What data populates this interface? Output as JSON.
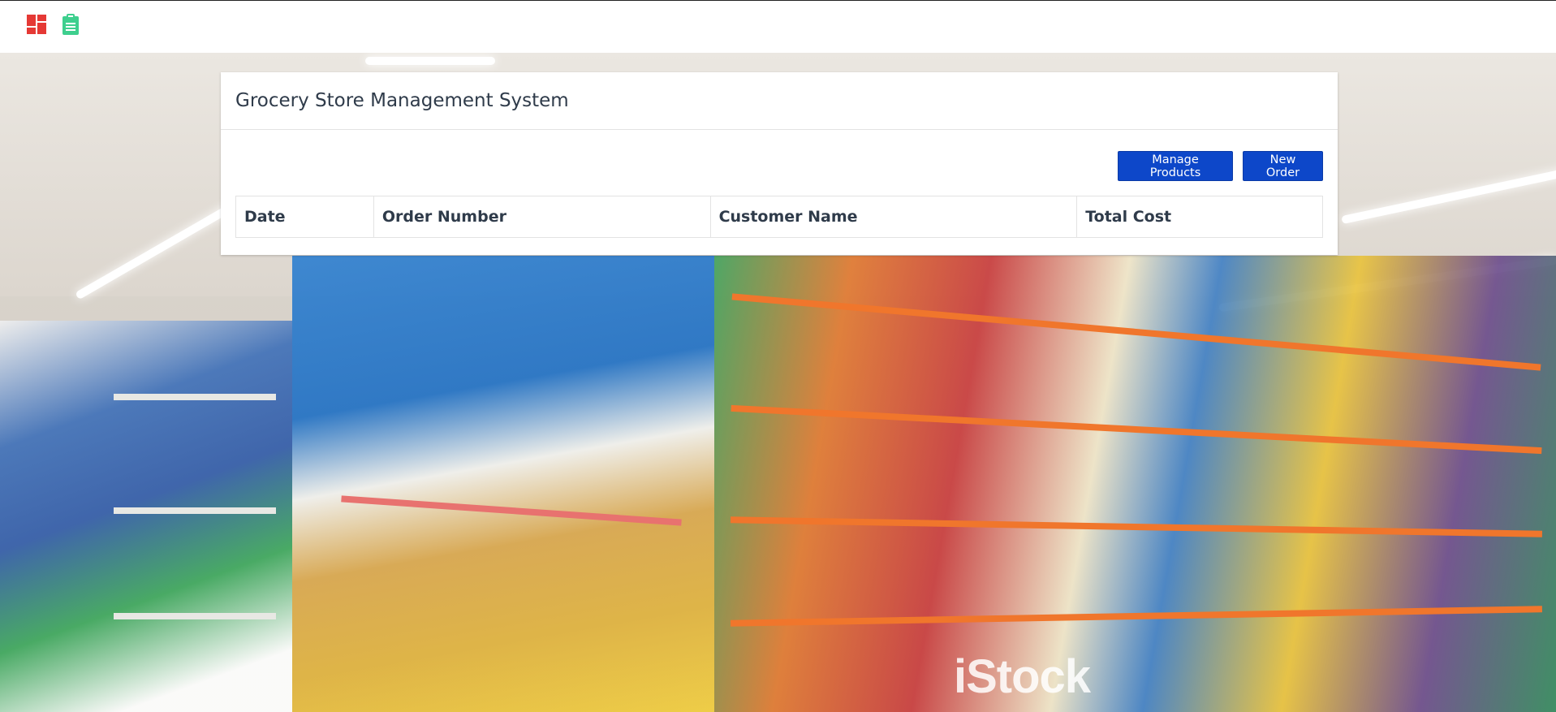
{
  "topbar": {
    "icons": [
      "dashboard-icon",
      "clipboard-icon"
    ],
    "colors": {
      "dashboard": "#e53935",
      "clipboard": "#3ecf8e"
    }
  },
  "background": {
    "watermark": "iStock"
  },
  "card": {
    "title": "Grocery Store Management System",
    "buttons": {
      "manage_products": "Manage Products",
      "new_order": "New Order"
    },
    "table": {
      "columns": [
        "Date",
        "Order Number",
        "Customer Name",
        "Total Cost"
      ],
      "rows": []
    }
  },
  "colors": {
    "primary_button": "#0d47c9",
    "title_text": "#2f3b4a"
  }
}
